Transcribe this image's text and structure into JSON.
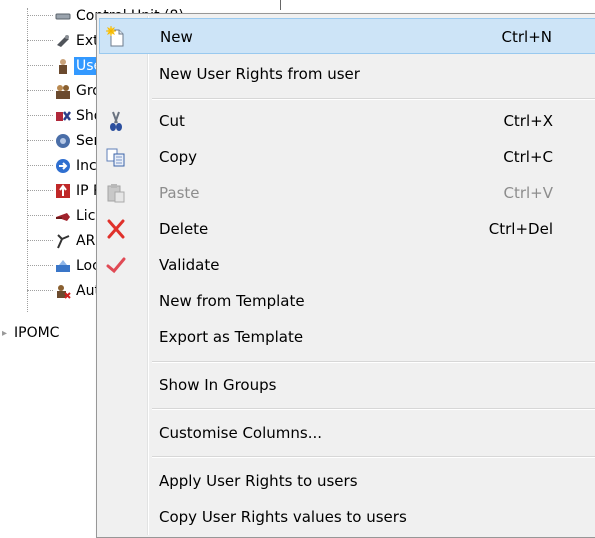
{
  "tree": {
    "items": [
      {
        "label": "Control Unit (8)",
        "icon": "control-unit-icon"
      },
      {
        "label": "Exter",
        "icon": "extension-icon"
      },
      {
        "label": "User",
        "icon": "user-icon"
      },
      {
        "label": "Grou",
        "icon": "group-icon"
      },
      {
        "label": "Shor",
        "icon": "short-code-icon"
      },
      {
        "label": "Servi",
        "icon": "service-icon"
      },
      {
        "label": "Incor",
        "icon": "incoming-call-route-icon"
      },
      {
        "label": "IP Ro",
        "icon": "ip-route-icon"
      },
      {
        "label": "Licer",
        "icon": "license-icon"
      },
      {
        "label": "ARS",
        "icon": "ars-icon"
      },
      {
        "label": "Loca",
        "icon": "location-icon"
      },
      {
        "label": "Auth",
        "icon": "authorization-icon"
      }
    ],
    "root": "IPOMC"
  },
  "context_menu": {
    "items": [
      {
        "label": "New",
        "shortcut": "Ctrl+N",
        "icon": "new-document-icon"
      },
      {
        "label": "New User Rights from user",
        "shortcut": ""
      },
      {
        "label": "Cut",
        "shortcut": "Ctrl+X",
        "icon": "scissors-icon"
      },
      {
        "label": "Copy",
        "shortcut": "Ctrl+C",
        "icon": "copy-icon"
      },
      {
        "label": "Paste",
        "shortcut": "Ctrl+V",
        "icon": "paste-icon"
      },
      {
        "label": "Delete",
        "shortcut": "Ctrl+Del",
        "icon": "delete-x-icon"
      },
      {
        "label": "Validate",
        "shortcut": "",
        "icon": "checkmark-icon"
      },
      {
        "label": "New from Template",
        "shortcut": ""
      },
      {
        "label": "Export as Template",
        "shortcut": ""
      },
      {
        "label": "Show In Groups",
        "shortcut": ""
      },
      {
        "label": "Customise Columns...",
        "shortcut": ""
      },
      {
        "label": "Apply User Rights to users",
        "shortcut": ""
      },
      {
        "label": "Copy User Rights values to users",
        "shortcut": ""
      }
    ]
  },
  "colors": {
    "highlight_bg": "#cde4f7",
    "highlight_border": "#99c9ef",
    "menu_bg": "#f0f0f0",
    "selection": "#3399ff",
    "delete_red": "#e0312b"
  }
}
